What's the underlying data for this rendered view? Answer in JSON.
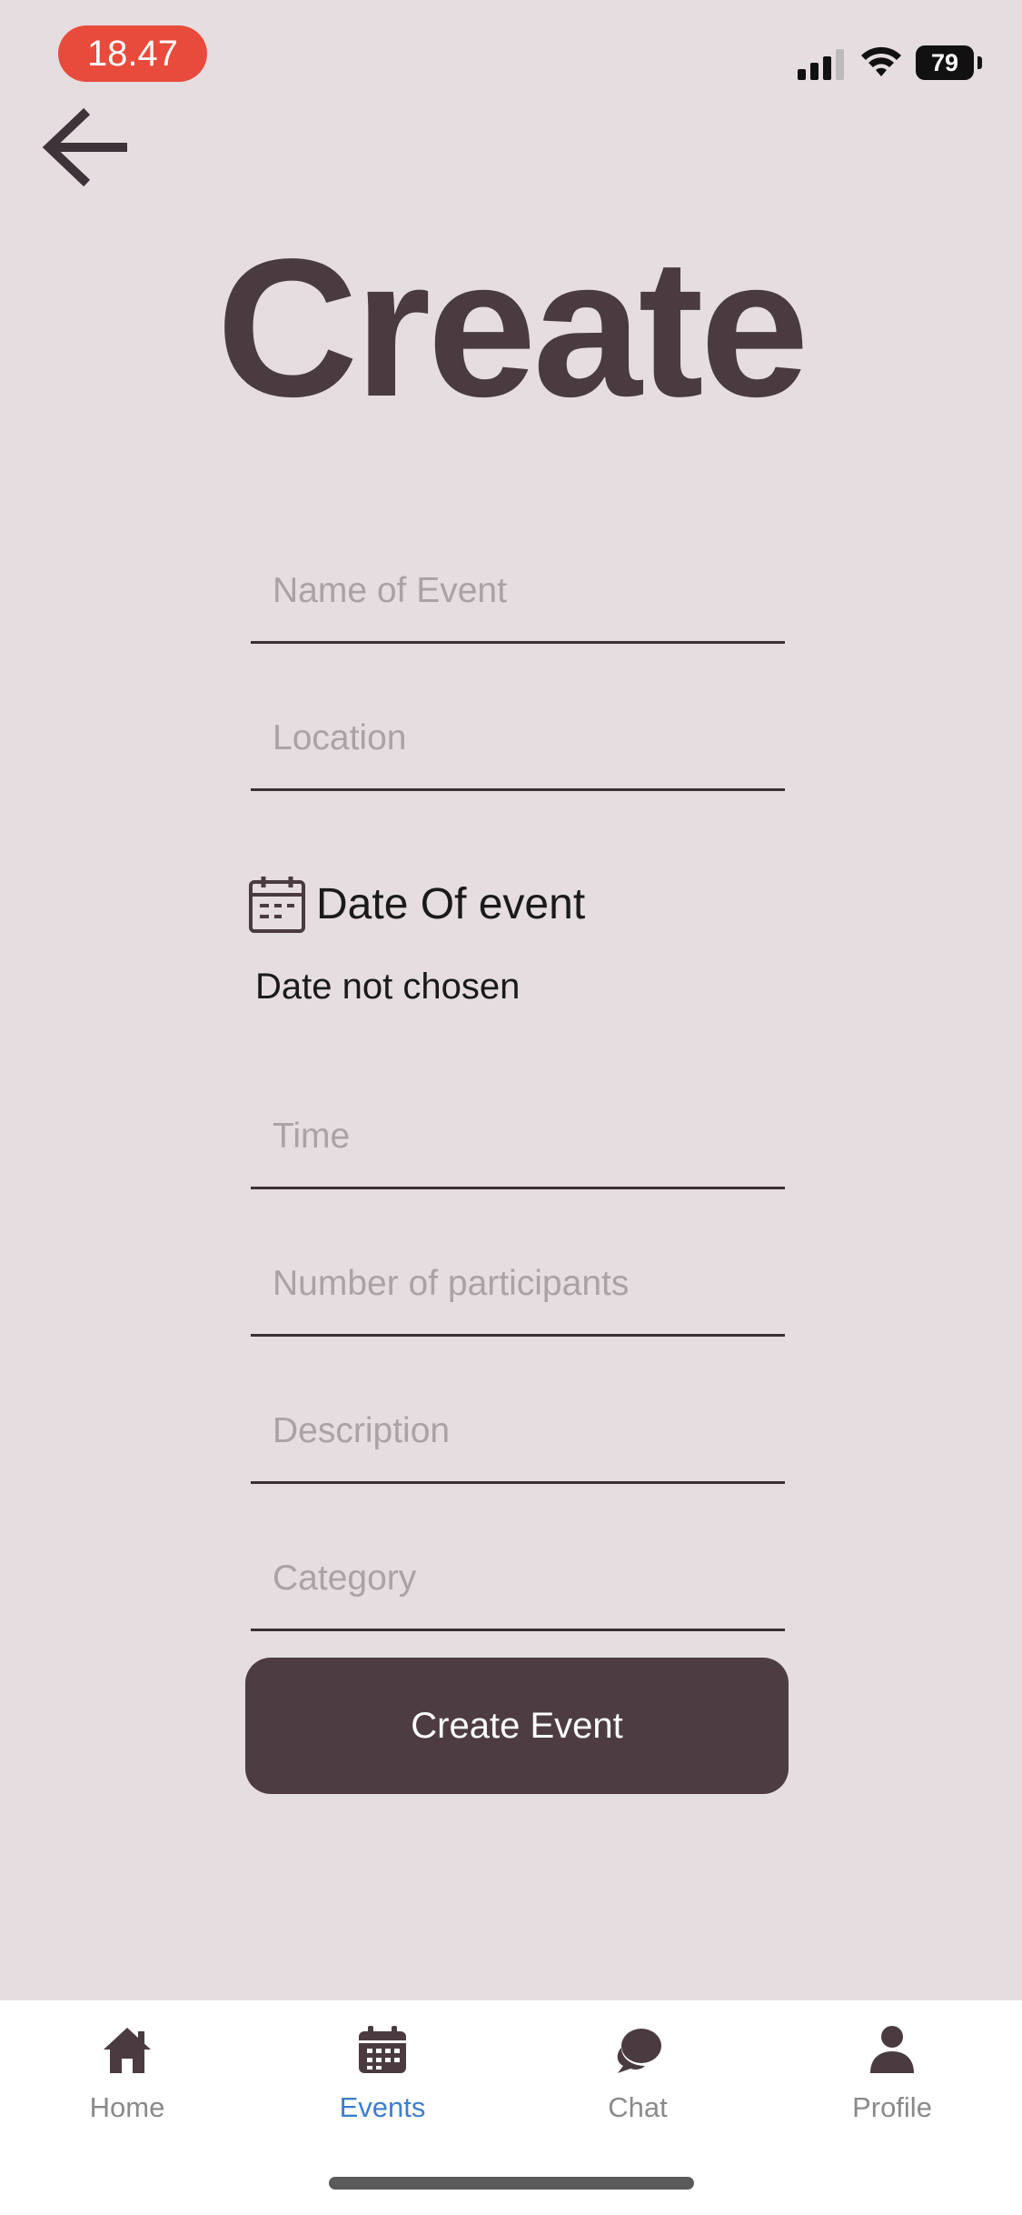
{
  "status_bar": {
    "time": "18.47",
    "battery": "79"
  },
  "header": {
    "title": "Create"
  },
  "form": {
    "name_placeholder": "Name of Event",
    "location_placeholder": "Location",
    "date_label": "Date Of event",
    "date_status": "Date not chosen",
    "time_placeholder": "Time",
    "participants_placeholder": "Number of participants",
    "description_placeholder": "Description",
    "category_placeholder": "Category",
    "submit_label": "Create Event"
  },
  "bottom_nav": {
    "items": [
      {
        "label": "Home",
        "icon": "home-icon",
        "active": false
      },
      {
        "label": "Events",
        "icon": "calendar-icon",
        "active": true
      },
      {
        "label": "Chat",
        "icon": "chat-icon",
        "active": false
      },
      {
        "label": "Profile",
        "icon": "profile-icon",
        "active": false
      }
    ]
  },
  "colors": {
    "background": "#e5dde0",
    "primary": "#4d3d43",
    "active_nav": "#3d7ecf",
    "time_pill": "#e84b3c"
  }
}
